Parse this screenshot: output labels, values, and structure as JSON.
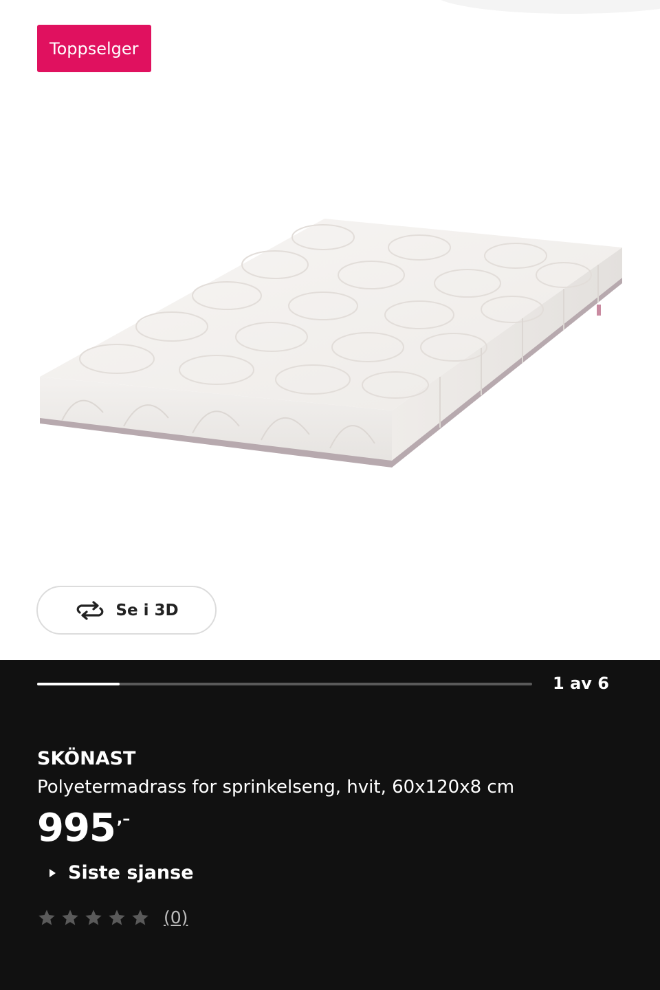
{
  "gallery": {
    "badge_label": "Toppselger",
    "badge_color": "#e0115f",
    "image_icon": "mattress-image",
    "view_3d_label": "Se i 3D",
    "view_3d_icon": "rotate-3d-icon"
  },
  "carousel": {
    "counter": "1 av 6",
    "current": 1,
    "total": 6
  },
  "product": {
    "name": "SKÖNAST",
    "description": "Polyetermadrass for sprinkelseng, hvit, 60x120x8 cm",
    "price_integer": "995",
    "price_suffix": ",–",
    "availability_label": "Siste sjanse",
    "rating_stars": 0,
    "rating_max": 5,
    "review_count": "(0)"
  },
  "colors": {
    "background": "#111111",
    "text": "#ffffff",
    "star_empty": "#5a5a5a"
  }
}
